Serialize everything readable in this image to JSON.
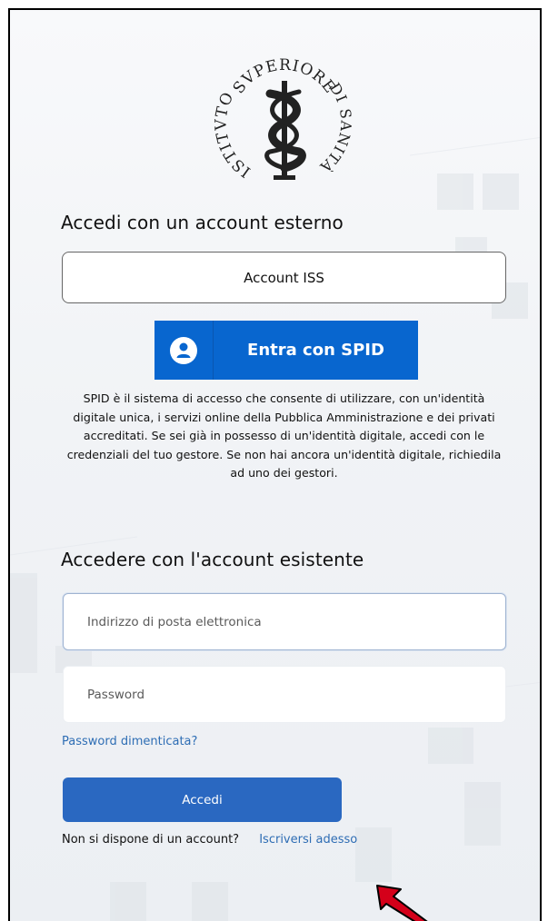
{
  "logo": {
    "text_top": "SVPERIORE",
    "text_left": "ISTITVTO",
    "text_right": "DI SANITÀ"
  },
  "external": {
    "title": "Accedi con un account esterno",
    "iss_button": "Account ISS",
    "spid_button": "Entra con SPID",
    "spid_description": "SPID è il sistema di accesso che consente di utilizzare, con un'identità digitale unica, i servizi online della Pubblica Amministrazione e dei privati accreditati. Se sei già in possesso di un'identità digitale, accedi con le credenziali del tuo gestore. Se non hai ancora un'identità digitale, richiedila ad uno dei gestori."
  },
  "existing": {
    "title": "Accedere con l'account esistente",
    "email_placeholder": "Indirizzo di posta elettronica",
    "email_value": "",
    "password_placeholder": "Password",
    "password_value": "",
    "forgot_link": "Password dimenticata?",
    "submit_button": "Accedi",
    "no_account_text": "Non si dispone di un account?",
    "signup_link": "Iscriversi adesso"
  },
  "colors": {
    "spid_blue": "#0866cf",
    "primary_button": "#2a68c1",
    "link": "#2e6db4",
    "annotation_arrow": "#d4001a"
  },
  "icons": [
    "institute-logo",
    "spid-user-icon",
    "red-annotation-arrow"
  ]
}
